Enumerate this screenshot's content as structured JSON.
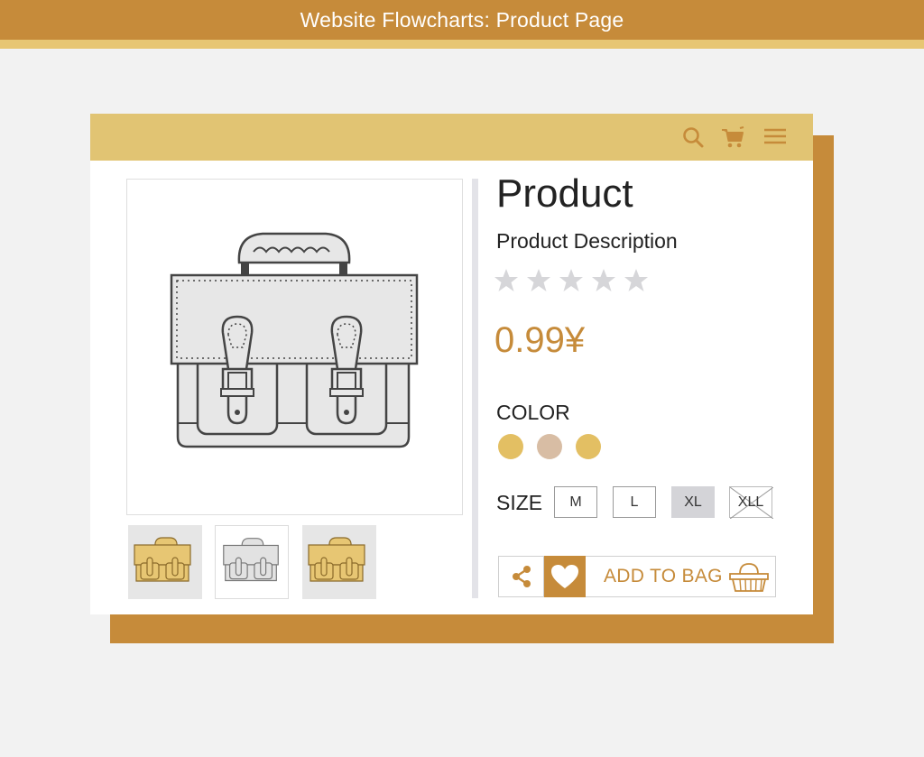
{
  "banner": {
    "title": "Website Flowcharts: Product Page"
  },
  "header": {
    "icons": [
      "search-icon",
      "cart-icon",
      "menu-icon"
    ]
  },
  "product": {
    "title": "Product",
    "description": "Product Description",
    "rating": {
      "value": 0,
      "max": 5
    },
    "price": "0.99¥"
  },
  "gallery": {
    "main_image": "satchel-bag",
    "thumbnails": [
      {
        "variant": "yellow"
      },
      {
        "variant": "gray",
        "selected": true
      },
      {
        "variant": "yellow"
      }
    ]
  },
  "color": {
    "label": "COLOR",
    "swatches": [
      "#e3bf63",
      "#d8bda4",
      "#e3bf63"
    ]
  },
  "size": {
    "label": "SIZE",
    "options": [
      {
        "label": "M"
      },
      {
        "label": "L"
      },
      {
        "label": "XL",
        "selected": true
      },
      {
        "label": "XLL",
        "unavailable": true
      }
    ]
  },
  "actions": {
    "add_to_bag": "ADD TO BAG"
  },
  "colors": {
    "accent": "#c68b3a",
    "header": "#e1c473",
    "stripe": "#e7c673"
  }
}
